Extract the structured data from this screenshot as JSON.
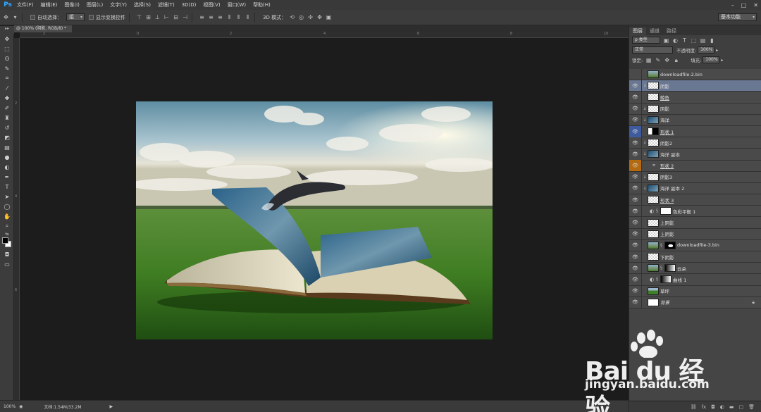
{
  "app": {
    "logo": "Ps"
  },
  "menu": [
    "文件(F)",
    "编辑(E)",
    "图像(I)",
    "图层(L)",
    "文字(Y)",
    "选择(S)",
    "滤镜(T)",
    "3D(D)",
    "视图(V)",
    "窗口(W)",
    "帮助(H)"
  ],
  "options": {
    "auto_select_label": "自动选择：",
    "auto_select_value": "组",
    "show_transform_label": "显示变换控件",
    "mode_3d_label": "3D 模式：",
    "workspace": "基本功能"
  },
  "document": {
    "tab_title": "@ 100% (阴影, RGB/8) *",
    "ruler_top": [
      "2",
      "0",
      "2",
      "4",
      "6",
      "8",
      "10"
    ],
    "ruler_left": [
      "2",
      "4",
      "6"
    ]
  },
  "status": {
    "zoom": "100%",
    "doc_size": "文档:1.54M/33.2M"
  },
  "panel": {
    "tabs": [
      "图层",
      "通道",
      "路径"
    ],
    "filter_label": "ρ 类型",
    "blend_mode": "正常",
    "opacity_label": "不透明度:",
    "opacity_value": "100%",
    "lock_label": "锁定:",
    "fill_label": "填充:",
    "fill_value": "100%"
  },
  "layers": [
    {
      "name": "downloadfile-2.bin",
      "thumb": "photo",
      "eye": "off",
      "clip": false
    },
    {
      "name": "阴影",
      "thumb": "check",
      "eye": "on",
      "clip": true,
      "selected": true
    },
    {
      "name": "鲸鱼",
      "thumb": "check",
      "eye": "on",
      "clip": false,
      "underline": true
    },
    {
      "name": "阴影",
      "thumb": "check",
      "eye": "on",
      "clip": true
    },
    {
      "name": "海洋",
      "thumb": "water",
      "eye": "on",
      "clip": true
    },
    {
      "name": "形状 1",
      "thumb": "black",
      "eye": "blue",
      "clip": false,
      "underline": true
    },
    {
      "name": "阴影2",
      "thumb": "check",
      "eye": "on",
      "clip": true
    },
    {
      "name": "海洋 副本",
      "thumb": "water",
      "eye": "on",
      "clip": true
    },
    {
      "name": "形状 2",
      "thumb": "none",
      "eye": "orange",
      "clip": false,
      "underline": true
    },
    {
      "name": "阴影3",
      "thumb": "check",
      "eye": "on",
      "clip": true
    },
    {
      "name": "海洋 副本 2",
      "thumb": "water",
      "eye": "on",
      "clip": true
    },
    {
      "name": "形状 3",
      "thumb": "check",
      "eye": "on",
      "clip": false,
      "underline": true
    },
    {
      "name": "色彩平衡 1",
      "thumb": "white",
      "eye": "on",
      "clip": false,
      "adjust": true
    },
    {
      "name": "上阴影",
      "thumb": "check",
      "eye": "on",
      "clip": false
    },
    {
      "name": "上阴影",
      "thumb": "check",
      "eye": "on",
      "clip": false
    },
    {
      "name": "downloadfile-3.bin",
      "thumb": "photo",
      "eye": "on",
      "clip": false,
      "mask": true
    },
    {
      "name": "下阴影",
      "thumb": "check",
      "eye": "on",
      "clip": false
    },
    {
      "name": "云朵",
      "thumb": "photo",
      "eye": "on",
      "clip": false,
      "mask2": true
    },
    {
      "name": "曲线 1",
      "thumb": "grad",
      "eye": "on",
      "clip": false,
      "adjust": true
    },
    {
      "name": "草坪",
      "thumb": "grass",
      "eye": "on",
      "clip": false
    },
    {
      "name": "背景",
      "thumb": "white",
      "eye": "on",
      "clip": false,
      "italic": true,
      "locked": true
    }
  ],
  "watermark": {
    "brand": "Bai du 经验",
    "url": "jingyan.baidu.com"
  }
}
